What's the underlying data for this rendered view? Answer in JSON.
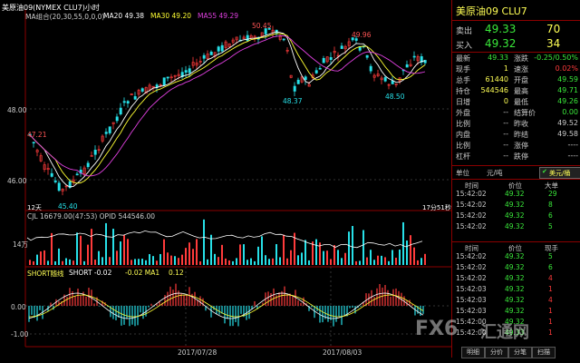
{
  "chart": {
    "header_title": "美原油09(NYMEX CLU7)小时",
    "ma_group_label": "MA组合(20,30,55,0,0,0)",
    "ma20_label": "MA20 49.38",
    "ma30_label": "MA30 49.20",
    "ma55_label": "MA55 49.29",
    "price_ticks": [
      "48.00",
      "46.00"
    ],
    "annotations": {
      "high1": "50.45",
      "high2": "49.96",
      "low1": "48.37",
      "low2": "48.50",
      "start": "47.21",
      "low_start": "45.40"
    },
    "bottom_left_label": "12天",
    "bottom_right_label": "17分51秒",
    "volume_header": "CJL 16679.00(47:53) OPID 544546.00",
    "volume_tick": "14万",
    "short_header_name": "SHORT随线",
    "short_header_short": "SHORT -0.02",
    "short_header_ma_label": "-0.02 MA1",
    "short_header_ma1": "0.12",
    "short_ticks": [
      "0.00",
      "-1.00"
    ],
    "x_dates": [
      "2017/07/28",
      "2017/08/03"
    ],
    "colors": {
      "up": "#ff3b3b",
      "down": "#27e0e8",
      "ma20": "#ffffff",
      "ma30": "#ffff33",
      "ma55": "#e040e0",
      "grid": "#8b0000"
    }
  },
  "quote": {
    "title": "美原油09  CLU7",
    "sell_label": "卖出",
    "sell_price": "49.33",
    "sell_vol": "70",
    "buy_label": "买入",
    "buy_price": "49.32",
    "buy_vol": "34",
    "rows_left": [
      {
        "label": "最新",
        "value": "49.33",
        "color": "#3ae83a"
      },
      {
        "label": "现手",
        "value": "1",
        "color": "#ffff55"
      },
      {
        "label": "总手",
        "value": "61440",
        "color": "#ffff55"
      },
      {
        "label": "持仓",
        "value": "544546",
        "color": "#ffff55"
      },
      {
        "label": "日增",
        "value": "0",
        "color": "#ffff55"
      },
      {
        "label": "外盘",
        "value": "--",
        "color": "#ccc"
      },
      {
        "label": "比例",
        "value": "--",
        "color": "#ccc"
      },
      {
        "label": "内盘",
        "value": "--",
        "color": "#ccc"
      },
      {
        "label": "比例",
        "value": "--",
        "color": "#ccc"
      },
      {
        "label": "杠杆",
        "value": "--",
        "color": "#ccc"
      }
    ],
    "rows_right": [
      {
        "label": "涨跌",
        "value": "-0.25/0.50%",
        "color": "#3ae83a"
      },
      {
        "label": "速涨",
        "value": "0.02%",
        "color": "#ff3b3b"
      },
      {
        "label": "开盘",
        "value": "49.59",
        "color": "#3ae83a"
      },
      {
        "label": "最高",
        "value": "49.71",
        "color": "#3ae83a"
      },
      {
        "label": "最低",
        "value": "49.26",
        "color": "#3ae83a"
      },
      {
        "label": "结算价",
        "value": "0.00",
        "color": "#3ae83a"
      },
      {
        "label": "昨收",
        "value": "49.52",
        "color": "#ccc"
      },
      {
        "label": "昨结",
        "value": "49.58",
        "color": "#ccc"
      },
      {
        "label": "涨停",
        "value": "----",
        "color": "#ccc"
      },
      {
        "label": "跌停",
        "value": "----",
        "color": "#ccc"
      }
    ],
    "unit_label": "单位",
    "unit_value": "元/吨",
    "unit_select": "美元/桶",
    "trade_headers": [
      "时间",
      "价位",
      "大单"
    ],
    "trades1": [
      {
        "time": "15:42:02",
        "price": "49.32",
        "vol": "29"
      },
      {
        "time": "15:42:02",
        "price": "49.32",
        "vol": "8"
      },
      {
        "time": "15:42:02",
        "price": "49.32",
        "vol": "6"
      },
      {
        "time": "15:42:02",
        "price": "49.32",
        "vol": "5"
      }
    ],
    "trade_headers2": [
      "时间",
      "价位",
      "现手"
    ],
    "trades2": [
      {
        "time": "15:42:02",
        "price": "49.32",
        "vol": "5",
        "vcolor": "#3ae83a"
      },
      {
        "time": "15:42:02",
        "price": "49.32",
        "vol": "6",
        "vcolor": "#3ae83a"
      },
      {
        "time": "15:42:02",
        "price": "49.32",
        "vol": "4",
        "vcolor": "#ff3b3b"
      },
      {
        "time": "15:42:03",
        "price": "49.32",
        "vol": "1",
        "vcolor": "#ff3b3b"
      },
      {
        "time": "15:42:03",
        "price": "49.32",
        "vol": "4",
        "vcolor": "#ff3b3b"
      },
      {
        "time": "15:42:03",
        "price": "49.32",
        "vol": "1",
        "vcolor": "#ff3b3b"
      },
      {
        "time": "15:42:00",
        "price": "49.32",
        "vol": "1",
        "vcolor": "#ff3b3b"
      },
      {
        "time": "15:42:00",
        "price": "49.33",
        "vol": "1",
        "vcolor": "#ff3b3b"
      }
    ],
    "tabs": [
      "明细",
      "分价",
      "分笔",
      "扫描"
    ]
  },
  "watermark": {
    "left": "FX6",
    "right": "汇通网"
  }
}
